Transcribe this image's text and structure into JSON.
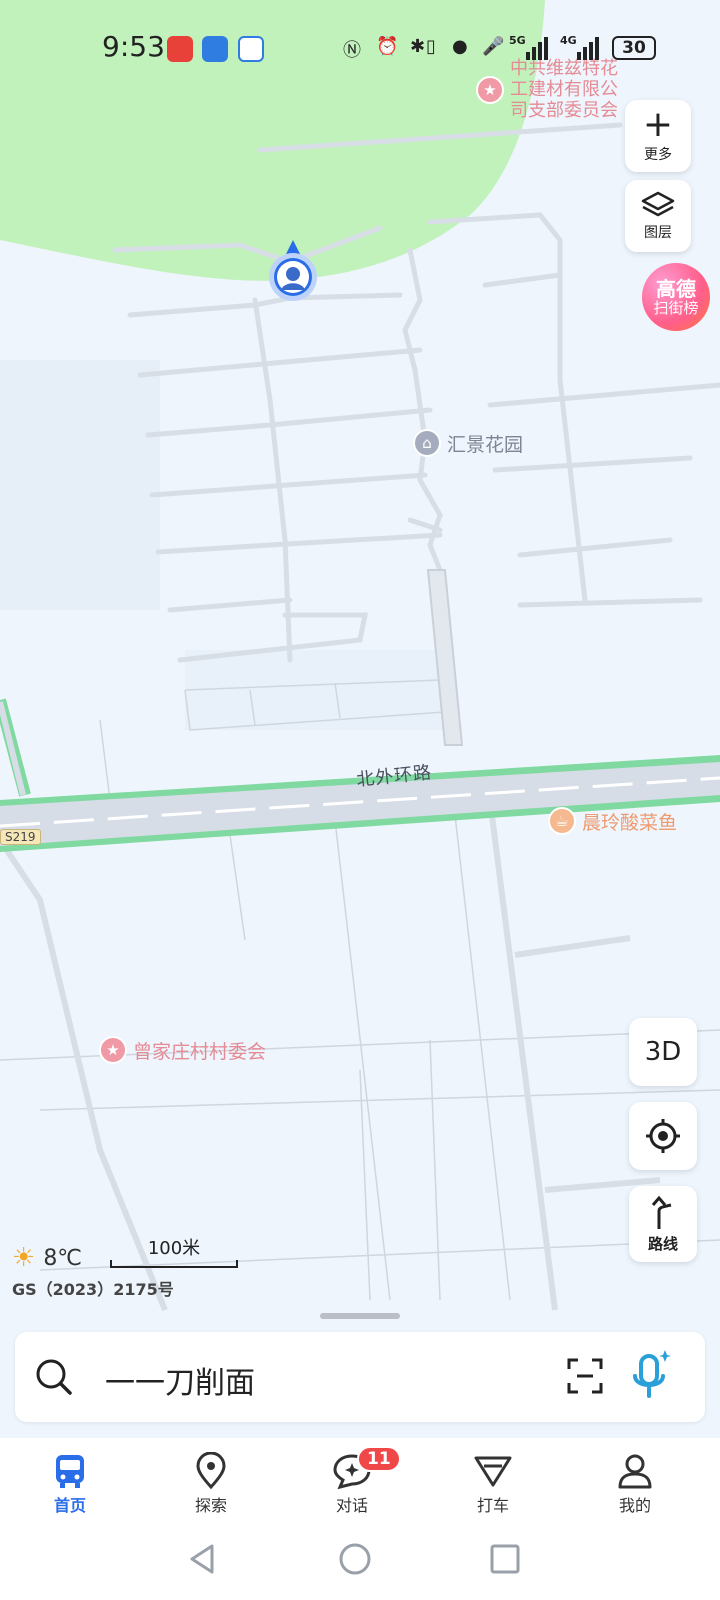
{
  "status_bar": {
    "time": "9:53",
    "signal_1": "5G",
    "signal_2": "4G",
    "battery": "30",
    "icons": [
      "nfc-icon",
      "alarm-icon",
      "bluetooth-icon",
      "vibrate-icon",
      "location-icon",
      "mic-icon"
    ]
  },
  "map": {
    "pois": [
      {
        "name": "中共维兹特花工建材有限公司支部委员会",
        "lines": [
          "中共维兹特花",
          "工建材有限公",
          "司支部委员会"
        ],
        "icon": "star-icon"
      },
      {
        "name": "汇景花园",
        "icon": "house-icon"
      },
      {
        "name": "晨玲酸菜鱼",
        "icon": "food-icon"
      },
      {
        "name": "曾家庄村村委会",
        "icon": "star-icon"
      }
    ],
    "road_name": "北外环路",
    "route_badge": "S219"
  },
  "controls": {
    "more_label": "更多",
    "layers_label": "图层",
    "ranking_line1": "高德",
    "ranking_line2": "扫街榜",
    "view3d_label": "3D",
    "route_label": "路线"
  },
  "weather": {
    "temperature": "8℃",
    "icon": "sun-icon"
  },
  "scale": {
    "label": "100米"
  },
  "map_license": "GS（2023）2175号",
  "search": {
    "query": "一一刀削面"
  },
  "nav": {
    "items": [
      {
        "label": "首页",
        "icon": "bus-icon",
        "active": true
      },
      {
        "label": "探索",
        "icon": "location-pin-icon"
      },
      {
        "label": "对话",
        "icon": "chat-icon",
        "badge": "11"
      },
      {
        "label": "打车",
        "icon": "taxi-icon"
      },
      {
        "label": "我的",
        "icon": "person-icon"
      }
    ]
  },
  "colors": {
    "accent": "#2a6de8",
    "park": "#c2f2bb",
    "road_border": "#7fd9a0",
    "badge": "#f04848"
  }
}
